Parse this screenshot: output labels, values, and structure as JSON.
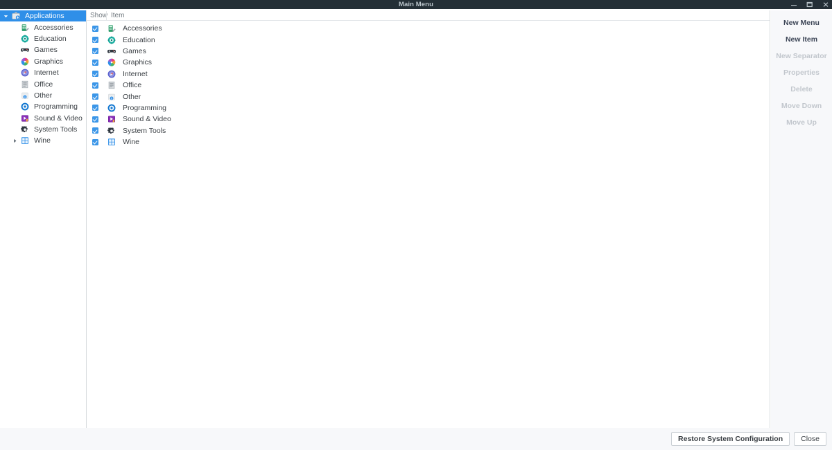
{
  "window": {
    "title": "Main Menu",
    "controls": [
      {
        "name": "minimize",
        "label": "Minimize"
      },
      {
        "name": "maximize",
        "label": "Maximize"
      },
      {
        "name": "close",
        "label": "Close"
      }
    ]
  },
  "sidebar": {
    "items": [
      {
        "label": "Applications",
        "icon": "applications-icon",
        "selected": true,
        "expanded": true,
        "has_children": true,
        "level": 0
      },
      {
        "label": "Accessories",
        "icon": "accessories-icon",
        "selected": false,
        "expanded": false,
        "has_children": false,
        "level": 1
      },
      {
        "label": "Education",
        "icon": "education-icon",
        "selected": false,
        "expanded": false,
        "has_children": false,
        "level": 1
      },
      {
        "label": "Games",
        "icon": "games-icon",
        "selected": false,
        "expanded": false,
        "has_children": false,
        "level": 1
      },
      {
        "label": "Graphics",
        "icon": "graphics-icon",
        "selected": false,
        "expanded": false,
        "has_children": false,
        "level": 1
      },
      {
        "label": "Internet",
        "icon": "internet-icon",
        "selected": false,
        "expanded": false,
        "has_children": false,
        "level": 1
      },
      {
        "label": "Office",
        "icon": "office-icon",
        "selected": false,
        "expanded": false,
        "has_children": false,
        "level": 1
      },
      {
        "label": "Other",
        "icon": "other-icon",
        "selected": false,
        "expanded": false,
        "has_children": false,
        "level": 1
      },
      {
        "label": "Programming",
        "icon": "programming-icon",
        "selected": false,
        "expanded": false,
        "has_children": false,
        "level": 1
      },
      {
        "label": "Sound & Video",
        "icon": "sound-video-icon",
        "selected": false,
        "expanded": false,
        "has_children": false,
        "level": 1
      },
      {
        "label": "System Tools",
        "icon": "system-tools-icon",
        "selected": false,
        "expanded": false,
        "has_children": false,
        "level": 1
      },
      {
        "label": "Wine",
        "icon": "wine-icon",
        "selected": false,
        "expanded": false,
        "has_children": true,
        "level": 1
      }
    ]
  },
  "list": {
    "columns": {
      "show": "Show",
      "item": "Item"
    },
    "rows": [
      {
        "label": "Accessories",
        "icon": "accessories-icon",
        "checked": true
      },
      {
        "label": "Education",
        "icon": "education-icon",
        "checked": true
      },
      {
        "label": "Games",
        "icon": "games-icon",
        "checked": true
      },
      {
        "label": "Graphics",
        "icon": "graphics-icon",
        "checked": true
      },
      {
        "label": "Internet",
        "icon": "internet-icon",
        "checked": true
      },
      {
        "label": "Office",
        "icon": "office-icon",
        "checked": true
      },
      {
        "label": "Other",
        "icon": "other-icon",
        "checked": true
      },
      {
        "label": "Programming",
        "icon": "programming-icon",
        "checked": true
      },
      {
        "label": "Sound & Video",
        "icon": "sound-video-icon",
        "checked": true
      },
      {
        "label": "System Tools",
        "icon": "system-tools-icon",
        "checked": true
      },
      {
        "label": "Wine",
        "icon": "wine-icon",
        "checked": true
      }
    ]
  },
  "actions": [
    {
      "label": "New Menu",
      "name": "new-menu-button",
      "enabled": true
    },
    {
      "label": "New Item",
      "name": "new-item-button",
      "enabled": true
    },
    {
      "label": "New Separator",
      "name": "new-separator-button",
      "enabled": false
    },
    {
      "label": "Properties",
      "name": "properties-button",
      "enabled": false
    },
    {
      "label": "Delete",
      "name": "delete-button",
      "enabled": false
    },
    {
      "label": "Move Down",
      "name": "move-down-button",
      "enabled": false
    },
    {
      "label": "Move Up",
      "name": "move-up-button",
      "enabled": false
    }
  ],
  "footer": {
    "restore_label": "Restore System Configuration",
    "close_label": "Close"
  },
  "colors": {
    "titlebar_bg": "#242f36",
    "titlebar_text": "#b9c3c9",
    "selection_blue": "#2f8fe8",
    "checkbox_blue": "#3b96e8",
    "panel_bg": "#f7f8fa",
    "border": "#d6dadd",
    "text": "#3b4045",
    "disabled_text": "#c2c7cd"
  }
}
